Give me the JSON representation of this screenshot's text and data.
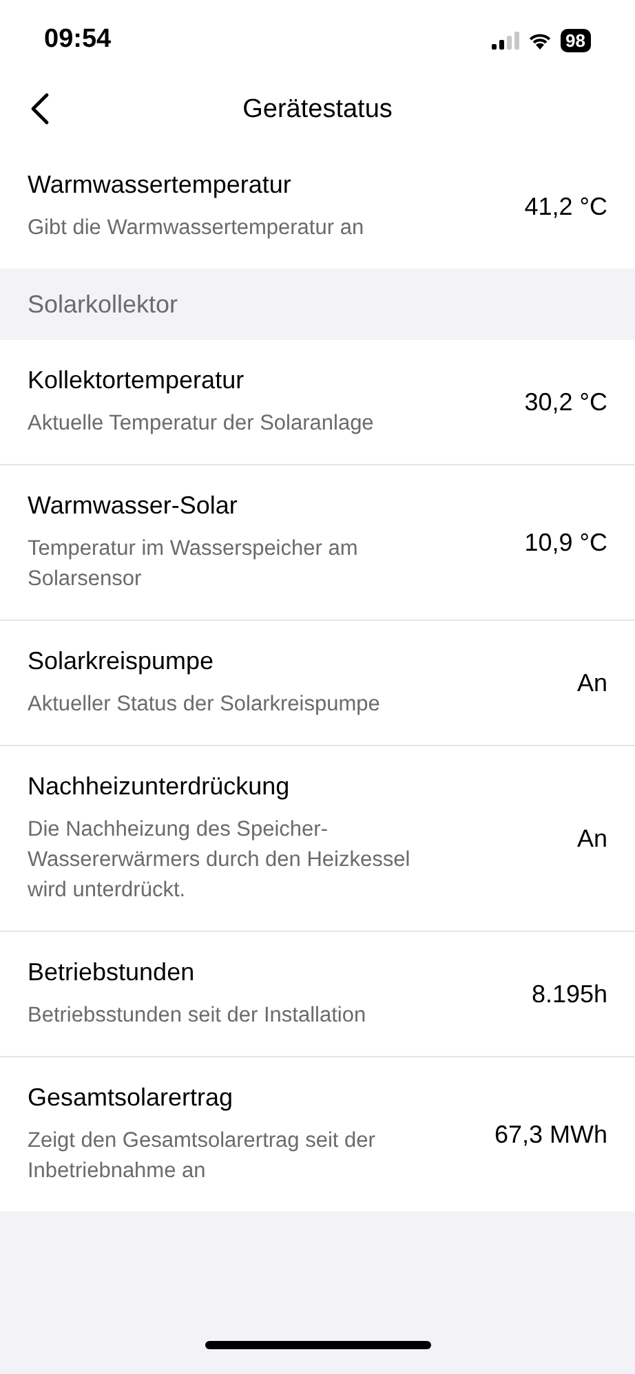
{
  "status_bar": {
    "time": "09:54",
    "battery": "98"
  },
  "header": {
    "title": "Gerätestatus"
  },
  "sections": [
    {
      "items": [
        {
          "title": "Warmwassertemperatur",
          "description": "Gibt die Warmwassertemperatur an",
          "value": "41,2 °C"
        }
      ]
    },
    {
      "heading": "Solarkollektor",
      "items": [
        {
          "title": "Kollektortemperatur",
          "description": "Aktuelle Temperatur der Solaranlage",
          "value": "30,2 °C"
        },
        {
          "title": "Warmwasser-Solar",
          "description": "Temperatur im Wasserspeicher am Solarsensor",
          "value": "10,9 °C"
        },
        {
          "title": "Solarkreispumpe",
          "description": "Aktueller Status der Solarkreispumpe",
          "value": "An"
        },
        {
          "title": "Nachheizunterdrückung",
          "description": "Die Nachheizung des Speicher-Wassererwärmers durch den Heizkessel wird unterdrückt.",
          "value": "An"
        },
        {
          "title": "Betriebstunden",
          "description": "Betriebsstunden seit der Installation",
          "value": "8.195h"
        },
        {
          "title": "Gesamtsolarertrag",
          "description": "Zeigt den Gesamtsolarertrag seit der Inbetriebnahme an",
          "value": "67,3 MWh"
        }
      ]
    }
  ]
}
